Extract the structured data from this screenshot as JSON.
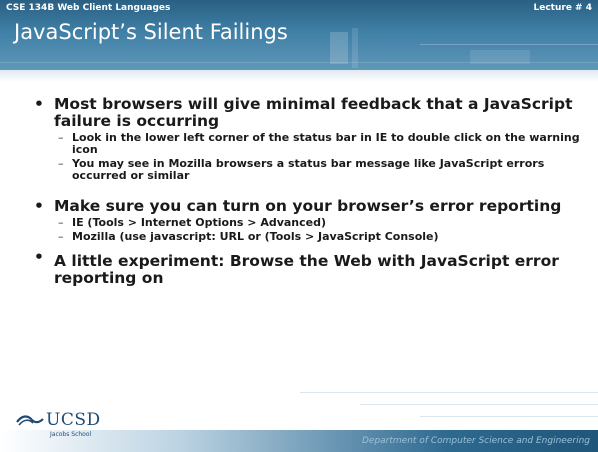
{
  "header": {
    "course": "CSE 134B  Web Client Languages",
    "lecture": "Lecture # 4",
    "title": "JavaScript’s Silent Failings"
  },
  "content": {
    "bullets": [
      {
        "text": "Most browsers will give minimal feedback that a JavaScript failure is occurring",
        "subs": [
          "Look in the lower left corner of the status bar in IE to double click on the warning icon",
          "You may see in Mozilla browsers a status bar message like JavaScript errors occurred or similar"
        ]
      },
      {
        "text": "Make sure you can turn on your browser’s error reporting",
        "subs": [
          "IE (Tools > Internet Options > Advanced)",
          "Mozilla (use javascript: URL or (Tools > JavaScript Console)"
        ]
      },
      {
        "text": "",
        "subs": []
      },
      {
        "text": "A little experiment: Browse the Web with JavaScript error reporting on",
        "subs": []
      }
    ]
  },
  "footer": {
    "logo_text": "UCSD",
    "logo_sub": "Jacobs School",
    "department": "Department of Computer Science and Engineering"
  },
  "colors": {
    "header_blue": "#3f7fa6",
    "footer_blue": "#2e6990",
    "text": "#1a1a1a"
  }
}
